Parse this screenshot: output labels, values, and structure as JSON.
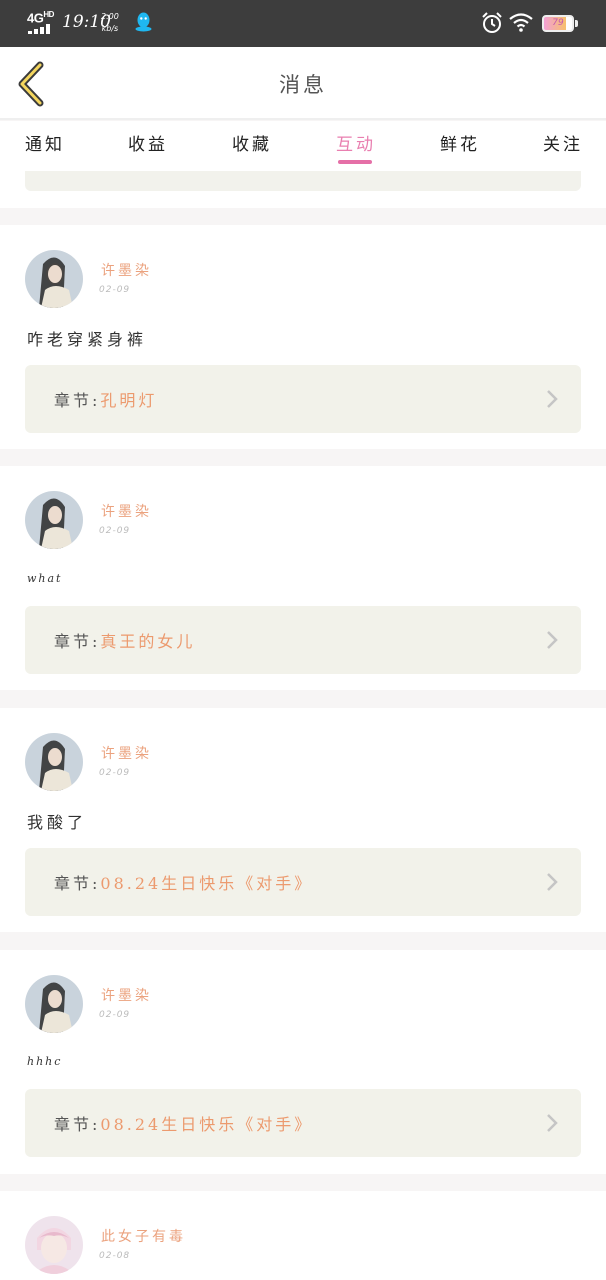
{
  "status_bar": {
    "network": "4G",
    "network_sup": "HD",
    "time": "19:10",
    "speed_value": "2.00",
    "speed_unit": "kb/s",
    "battery": "79",
    "battery_level": 0.79,
    "icons": [
      "qq-icon",
      "alarm-icon",
      "wifi-icon",
      "battery-icon"
    ]
  },
  "header": {
    "title": "消息",
    "back_icon": "chevron-left-icon"
  },
  "tabs": [
    {
      "label": "通知",
      "active": false
    },
    {
      "label": "收益",
      "active": false
    },
    {
      "label": "收藏",
      "active": false
    },
    {
      "label": "互动",
      "active": true
    },
    {
      "label": "鲜花",
      "active": false
    },
    {
      "label": "关注",
      "active": false
    }
  ],
  "colors": {
    "accent": "#e56fa7",
    "username": "#eba27e",
    "chapter_bg": "#f2f2ea"
  },
  "chapter_prefix": "章节:",
  "messages": [
    {
      "username": "许墨染",
      "date": "02-09",
      "comment": "咋老穿紧身裤",
      "chapter": "孔明灯"
    },
    {
      "username": "许墨染",
      "date": "02-09",
      "comment": "what",
      "chapter": "真王的女儿"
    },
    {
      "username": "许墨染",
      "date": "02-09",
      "comment": "我酸了",
      "chapter": "08.24生日快乐《对手》"
    },
    {
      "username": "许墨染",
      "date": "02-09",
      "comment": "hhhc",
      "chapter": "08.24生日快乐《对手》"
    },
    {
      "username": "此女子有毒",
      "date": "02-08"
    }
  ]
}
